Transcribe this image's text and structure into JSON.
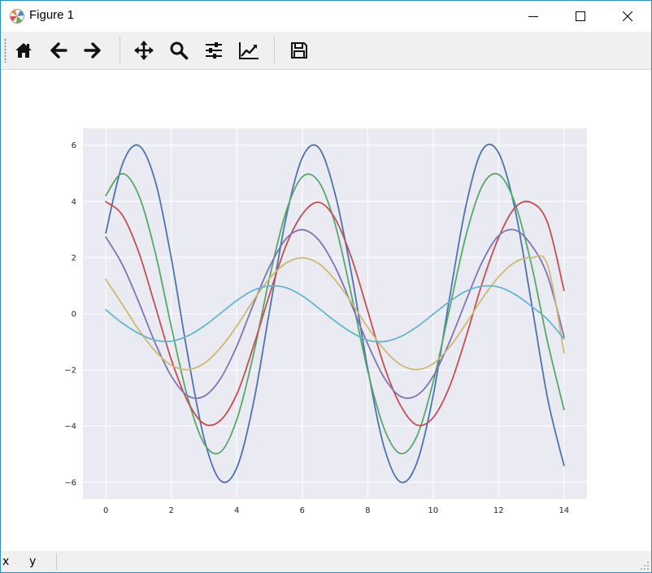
{
  "window": {
    "title": "Figure 1",
    "icons": {
      "app": "matplotlib-icon",
      "minimize": "minimize-icon",
      "maximize": "maximize-icon",
      "close": "close-icon"
    }
  },
  "toolbar": {
    "buttons": [
      {
        "name": "home-button",
        "icon": "home-icon"
      },
      {
        "name": "back-button",
        "icon": "arrow-left-icon"
      },
      {
        "name": "forward-button",
        "icon": "arrow-right-icon"
      },
      {
        "name": "pan-button",
        "icon": "move-arrows-icon"
      },
      {
        "name": "zoom-button",
        "icon": "magnifier-icon"
      },
      {
        "name": "subplots-button",
        "icon": "sliders-icon"
      },
      {
        "name": "edit-axes-button",
        "icon": "line-chart-icon"
      },
      {
        "name": "save-button",
        "icon": "floppy-disk-icon"
      }
    ]
  },
  "status": {
    "x_label": "x",
    "y_label": "y"
  },
  "chart_data": {
    "type": "line",
    "title": "",
    "xlabel": "",
    "ylabel": "",
    "xlim": [
      -0.7,
      14.7
    ],
    "ylim": [
      -6.6,
      6.6
    ],
    "xticks": [
      0,
      2,
      4,
      6,
      8,
      10,
      12,
      14
    ],
    "yticks": [
      -6,
      -4,
      -2,
      0,
      2,
      4,
      6
    ],
    "grid": true,
    "background": "#eaeaf2",
    "x": [
      0,
      0.5,
      1,
      1.5,
      2,
      2.5,
      3,
      3.5,
      4,
      4.5,
      5,
      5.5,
      6,
      6.5,
      7,
      7.5,
      8,
      8.5,
      9,
      9.5,
      10,
      10.5,
      11,
      11.5,
      12,
      12.5,
      13,
      13.5,
      14
    ],
    "series": [
      {
        "color": "#4c72b0",
        "values": [
          2.88,
          5.3,
          5.99,
          4.76,
          1.98,
          -1.45,
          -4.43,
          -5.94,
          -5.49,
          -3.24,
          0.09,
          3.38,
          5.55,
          5.92,
          4.29,
          1.46,
          -1.94,
          -4.74,
          -5.99,
          -5.32,
          -2.92,
          0.55,
          3.83,
          5.83,
          5.73,
          3.73,
          0.41,
          -3.03,
          -5.41
        ]
      },
      {
        "color": "#55a868",
        "values": [
          4.21,
          4.99,
          4.24,
          2.23,
          -0.46,
          -2.98,
          -4.62,
          -4.93,
          -3.77,
          -1.51,
          1.28,
          3.61,
          4.87,
          4.71,
          3.21,
          0.69,
          -2.03,
          -4.08,
          -4.98,
          -4.37,
          -2.44,
          0.16,
          2.77,
          4.55,
          4.96,
          3.94,
          1.77,
          -1.02,
          -3.42
        ]
      },
      {
        "color": "#c44e52",
        "values": [
          3.99,
          3.52,
          2.21,
          0.31,
          -1.63,
          -3.12,
          -3.92,
          -3.8,
          -2.87,
          -1.2,
          0.68,
          2.41,
          3.54,
          3.97,
          3.4,
          2.01,
          0.11,
          -1.85,
          -3.26,
          -3.96,
          -3.7,
          -2.6,
          -0.85,
          1.1,
          2.71,
          3.78,
          3.96,
          3.23,
          0.83
        ]
      },
      {
        "color": "#8172b2",
        "values": [
          2.73,
          1.76,
          0.43,
          -1.02,
          -2.22,
          -2.92,
          -2.94,
          -2.32,
          -1.16,
          0.31,
          1.67,
          2.66,
          2.99,
          2.63,
          1.68,
          0.34,
          -1.07,
          -2.27,
          -2.94,
          -2.91,
          -2.23,
          -1.01,
          0.45,
          1.85,
          2.78,
          2.98,
          2.45,
          1.34,
          -0.82
        ]
      },
      {
        "color": "#ccb974",
        "values": [
          1.22,
          0.34,
          -0.56,
          -1.32,
          -1.83,
          -1.99,
          -1.77,
          -1.22,
          -0.44,
          0.46,
          1.25,
          1.8,
          1.99,
          1.79,
          1.21,
          0.41,
          -0.48,
          -1.27,
          -1.81,
          -1.99,
          -1.78,
          -1.19,
          -0.36,
          0.54,
          1.31,
          1.83,
          1.99,
          1.73,
          -1.39
        ]
      },
      {
        "color": "#64b5cd",
        "values": [
          0.14,
          -0.33,
          -0.7,
          -0.94,
          -0.98,
          -0.79,
          -0.44,
          0.01,
          0.47,
          0.83,
          0.99,
          0.93,
          0.64,
          0.2,
          -0.26,
          -0.66,
          -0.94,
          -0.99,
          -0.82,
          -0.47,
          -0.02,
          0.43,
          0.8,
          0.98,
          0.95,
          0.69,
          0.27,
          -0.21,
          -0.9
        ]
      }
    ]
  }
}
